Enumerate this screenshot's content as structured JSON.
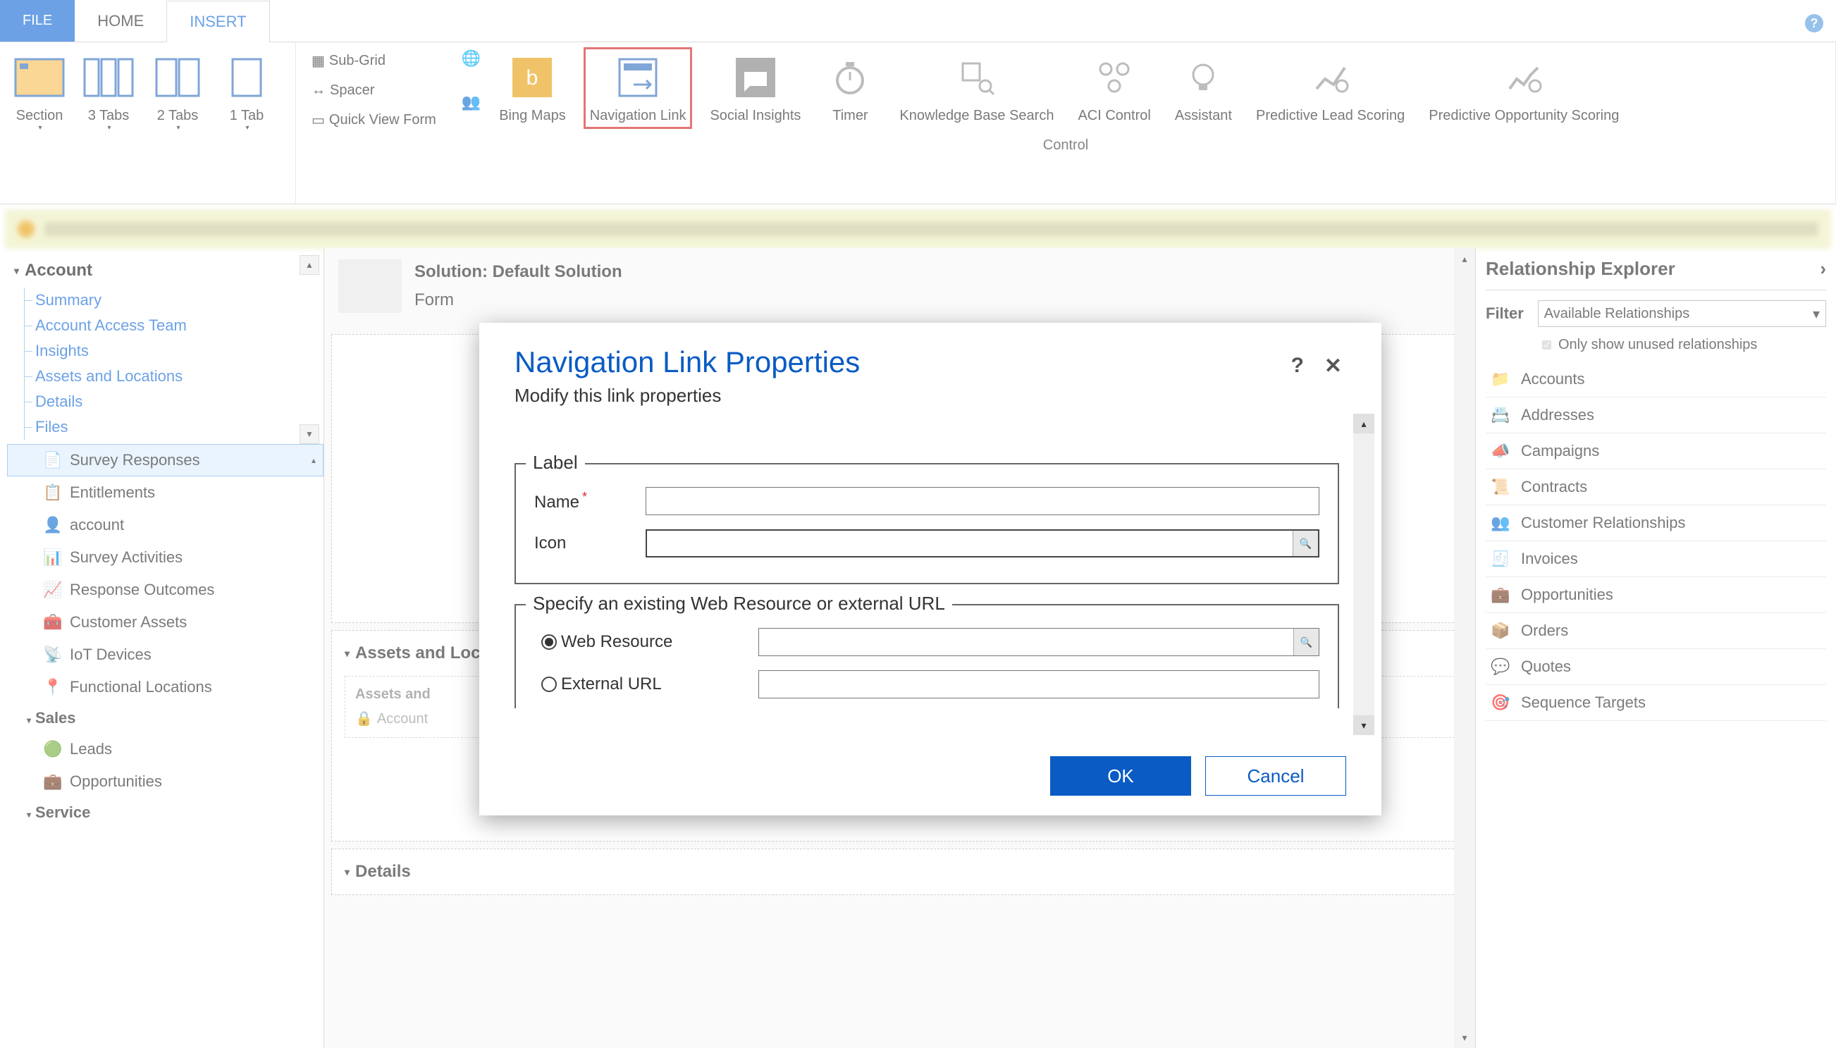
{
  "tabs": {
    "file": "FILE",
    "home": "HOME",
    "insert": "INSERT"
  },
  "ribbon": {
    "section": "Section",
    "tabs3": "3 Tabs",
    "tabs2": "2 Tabs",
    "tab1": "1 Tab",
    "subgrid": "Sub-Grid",
    "spacer": "Spacer",
    "quickview": "Quick View Form",
    "bingmaps": "Bing Maps",
    "navlink": "Navigation Link",
    "social": "Social Insights",
    "timer": "Timer",
    "kbs": "Knowledge Base Search",
    "aci": "ACI Control",
    "assistant": "Assistant",
    "leadscore": "Predictive Lead Scoring",
    "oppscore": "Predictive Opportunity Scoring",
    "groupLabel": "Control"
  },
  "left": {
    "account": "Account",
    "links": [
      "Summary",
      "Account Access Team",
      "Insights",
      "Assets and Locations",
      "Details",
      "Files"
    ],
    "navSelected": "Survey Responses",
    "navItems": [
      "Entitlements",
      "account",
      "Survey Activities",
      "Response Outcomes",
      "Customer Assets",
      "IoT Devices",
      "Functional Locations"
    ],
    "sales": "Sales",
    "salesItems": [
      "Leads",
      "Opportunities"
    ],
    "service": "Service"
  },
  "center": {
    "solutionLabel": "Solution: Default Solution",
    "formLabel": "Form",
    "block1Title": "Assets and Locations",
    "block1Sub": "Assets and",
    "block1Field": "Account",
    "block2Title": "Details"
  },
  "right": {
    "title": "Relationship Explorer",
    "filterLabel": "Filter",
    "filterValue": "Available Relationships",
    "onlyUnused": "Only show unused relationships",
    "items": [
      "Accounts",
      "Addresses",
      "Campaigns",
      "Contracts",
      "Customer Relationships",
      "Invoices",
      "Opportunities",
      "Orders",
      "Quotes",
      "Sequence Targets"
    ]
  },
  "dialog": {
    "title": "Navigation Link Properties",
    "subtitle": "Modify this link properties",
    "legend1": "Label",
    "nameLabel": "Name",
    "iconLabel": "Icon",
    "legend2": "Specify an existing Web Resource or external URL",
    "webres": "Web Resource",
    "exturl": "External URL",
    "ok": "OK",
    "cancel": "Cancel"
  }
}
